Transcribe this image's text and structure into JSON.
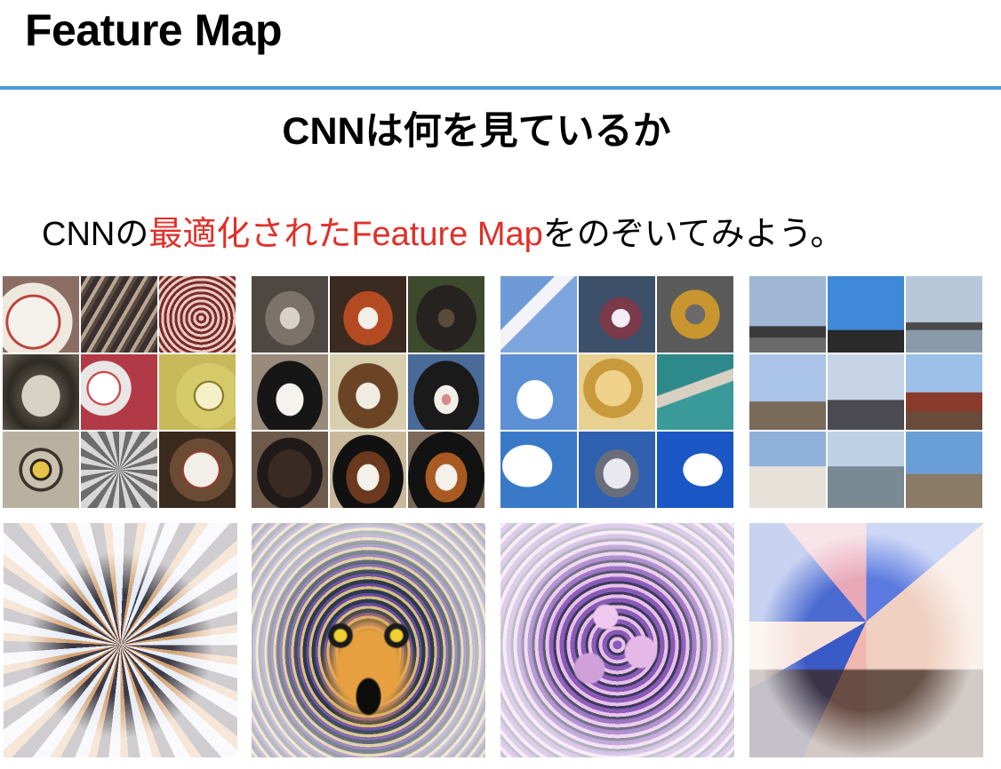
{
  "slide": {
    "title": "Feature Map",
    "heading": "CNNは何を見ているか",
    "caption": {
      "prefix": "CNNの",
      "highlight": "最適化されたFeature Map",
      "suffix": "をのぞいてみよう。"
    }
  },
  "colors": {
    "rule": "#4a9ad8",
    "highlight": "#e0302a"
  },
  "figure": {
    "groups": [
      {
        "id": "group-1",
        "theme": "baseball / round patterns"
      },
      {
        "id": "group-2",
        "theme": "animal faces"
      },
      {
        "id": "group-3",
        "theme": "clouds and textures"
      },
      {
        "id": "group-4",
        "theme": "towers and domes"
      }
    ]
  }
}
